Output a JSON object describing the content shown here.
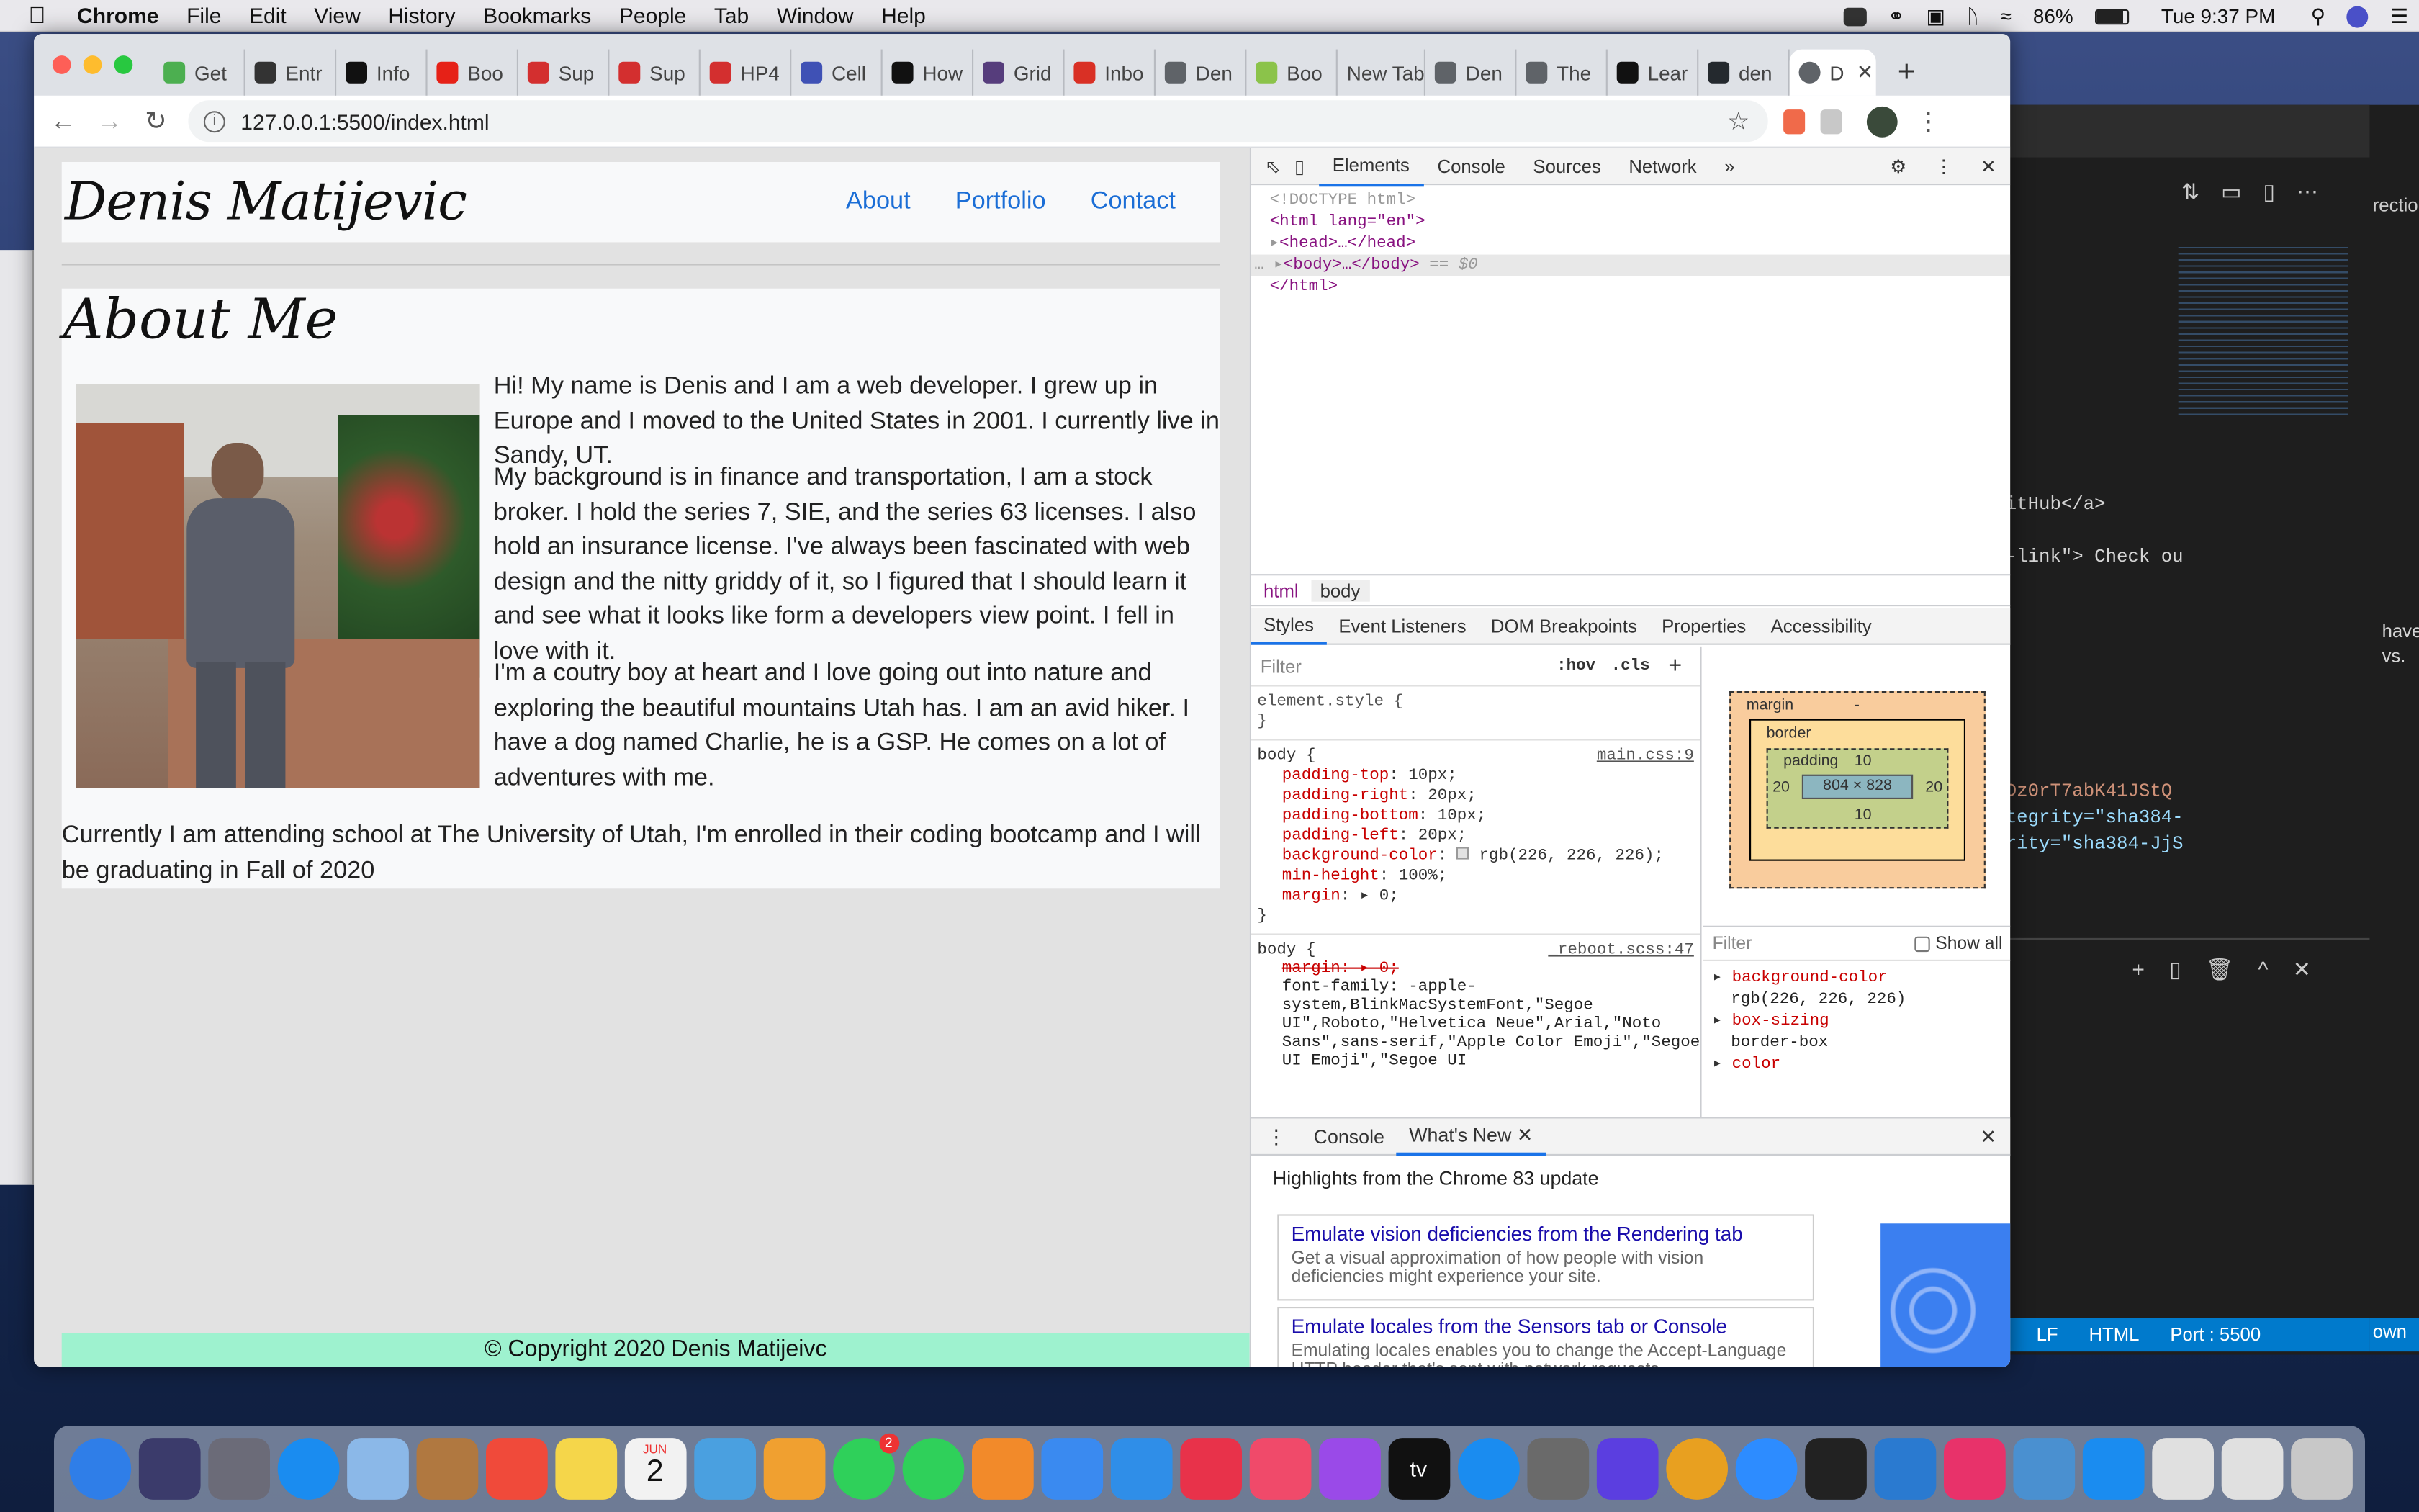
{
  "menubar": {
    "app": "Chrome",
    "items": [
      "File",
      "Edit",
      "View",
      "History",
      "Bookmarks",
      "People",
      "Tab",
      "Window",
      "Help"
    ],
    "battery": "86%",
    "clock": "Tue 9:37 PM"
  },
  "tabs": [
    {
      "label": "Get",
      "color": "#4caf50"
    },
    {
      "label": "Entr",
      "color": "#333333"
    },
    {
      "label": "Info",
      "color": "#111111"
    },
    {
      "label": "Boo",
      "color": "#e62117"
    },
    {
      "label": "Sup",
      "color": "#d32f2f"
    },
    {
      "label": "Sup",
      "color": "#d32f2f"
    },
    {
      "label": "HP4",
      "color": "#d32f2f"
    },
    {
      "label": "Cell",
      "color": "#3f51b5"
    },
    {
      "label": "How",
      "color": "#111111"
    },
    {
      "label": "Grid",
      "color": "#563d7c"
    },
    {
      "label": "Inbo",
      "color": "#d93025"
    },
    {
      "label": "Den",
      "color": "#5f6368"
    },
    {
      "label": "Boo",
      "color": "#8bc34a"
    },
    {
      "label": "New Tab",
      "color": ""
    },
    {
      "label": "Den",
      "color": "#5f6368"
    },
    {
      "label": "The",
      "color": "#5f6368"
    },
    {
      "label": "Lear",
      "color": "#111111"
    },
    {
      "label": "den",
      "color": "#24292e"
    }
  ],
  "active_tab": {
    "label": "D"
  },
  "url": "127.0.0.1:5500/index.html",
  "site": {
    "brand": "Denis Matijevic",
    "nav": [
      "About",
      "Portfolio",
      "Contact"
    ],
    "heading": "About Me",
    "p1": "Hi! My name is Denis and I am a web developer. I grew up in Europe and I moved to the United States in 2001. I currently live in Sandy, UT.",
    "p2": "My background is in finance and transportation, I am a stock broker. I hold the series 7, SIE, and the series 63 licenses. I also hold an insurance license. I've always been fascinated with web design and the nitty griddy of it, so I figured that I should learn it and see what it looks like form a developers view point. I fell in love with it.",
    "p3": "I'm a coutry boy at heart and I love going out into nature and exploring the beautiful mountains Utah has. I am an avid hiker. I have a dog named Charlie, he is a GSP. He comes on a lot of adventures with me.",
    "p4": "Currently I am attending school at The University of Utah, I'm enrolled in their coding bootcamp and I will be graduating in Fall of 2020",
    "footer": "© Copyright 2020 Denis Matijeivc"
  },
  "devtools": {
    "tabs": [
      "Elements",
      "Console",
      "Sources",
      "Network"
    ],
    "dom": {
      "doctype": "<!DOCTYPE html>",
      "html_open": "<html lang=\"en\">",
      "head": "<head>…</head>",
      "body": "<body>…</body>",
      "eq": "== $0",
      "html_close": "</html>"
    },
    "breadcrumb": [
      "html",
      "body"
    ],
    "subtabs": [
      "Styles",
      "Event Listeners",
      "DOM Breakpoints",
      "Properties",
      "Accessibility"
    ],
    "filter": "Filter",
    "hov": ":hov",
    "cls": ".cls",
    "element_style": "element.style {",
    "rule1": {
      "selector": "body {",
      "source": "main.css:9",
      "props": [
        [
          "padding-top",
          "10px;"
        ],
        [
          "padding-right",
          "20px;"
        ],
        [
          "padding-bottom",
          "10px;"
        ],
        [
          "padding-left",
          "20px;"
        ],
        [
          "background-color",
          "rgb(226, 226, 226);"
        ],
        [
          "min-height",
          "100%;"
        ],
        [
          "margin",
          "▸ 0;"
        ]
      ]
    },
    "rule2": {
      "selector": "body {",
      "source": "_reboot.scss:47",
      "margin": "margin: ▸ 0;",
      "font_family": "font-family: -apple-system,BlinkMacSystemFont,\"Segoe UI\",Roboto,\"Helvetica Neue\",Arial,\"Noto Sans\",sans-serif,\"Apple Color Emoji\",\"Segoe UI Emoji\",\"Segoe UI"
    },
    "boxmodel": {
      "margin": "margin",
      "border": "border",
      "padding": "padding",
      "pad_top": "10",
      "pad_left": "20",
      "pad_right": "20",
      "pad_bottom": "10",
      "content": "804 × 828",
      "dash": "-"
    },
    "computed": {
      "filter": "Filter",
      "show_all": "Show all",
      "items": [
        [
          "background-color",
          "rgb(226, 226, 226)"
        ],
        [
          "box-sizing",
          "border-box"
        ],
        [
          "color",
          ""
        ]
      ]
    },
    "drawer": {
      "tabs": [
        "Console",
        "What's New"
      ],
      "highlights": "Highlights from the Chrome 83 update",
      "cards": [
        {
          "title": "Emulate vision deficiencies from the Rendering tab",
          "desc": "Get a visual approximation of how people with vision deficiencies might experience your site."
        },
        {
          "title": "Emulate locales from the Sensors tab or Console",
          "desc": "Emulating locales enables you to change the Accept-Language HTTP header that's sent with network requests."
        }
      ]
    }
  },
  "editor": {
    "lines": [
      "itHub</a>",
      "-link\"> Check ou",
      "Dz0rT7abK41JStQ",
      "tegrity=\"sha384-",
      "rity=\"sha384-JjS"
    ],
    "status": [
      "LF",
      "HTML",
      "Port : 5500"
    ],
    "side_text": [
      "have",
      "vs."
    ],
    "side_label": "rectio",
    "own": "own"
  },
  "dock": {
    "calendar_month": "JUN",
    "calendar_day": "2",
    "messages_badge": "2",
    "tv": "tv",
    "colors": [
      "#2f7ee8",
      "#3b3b6b",
      "#6b6b78",
      "#1a8cf0",
      "#8bb8e8",
      "#b07840",
      "#f04a3a",
      "#f5d64a",
      "#f2f2f2",
      "#4aa0e0",
      "#f0a030",
      "#2fd05a",
      "#2fd05a",
      "#f28a2a",
      "#3a8af0",
      "#2f8ee8",
      "#e8324a",
      "#f04a6a",
      "#9a4ae8",
      "#111111",
      "#1a8cf0",
      "#6a6a6a",
      "#5b3ee0",
      "#e8a020",
      "#2d8cff",
      "#222222",
      "#2a7ad0",
      "#e8326a",
      "#4a90d0",
      "#1a8cf0",
      "#e0e0e0",
      "#e0e0e0",
      "#c8c8c8"
    ]
  }
}
